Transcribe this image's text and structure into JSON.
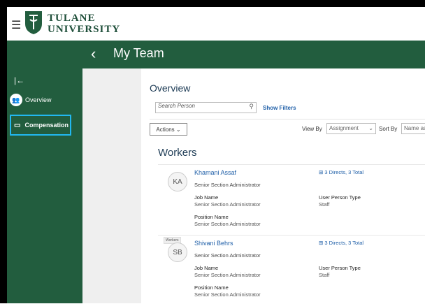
{
  "brand": {
    "line1": "TULANE",
    "line2": "UNIVERSITY"
  },
  "header": {
    "title": "My Team"
  },
  "sidebar": {
    "items": [
      {
        "label": "Overview",
        "icon": "team-icon",
        "active": false
      },
      {
        "label": "Compensation",
        "icon": "compensation-icon",
        "active": true
      }
    ]
  },
  "main": {
    "title": "Overview",
    "search_placeholder": "Search Person",
    "show_filters": "Show Filters",
    "actions_label": "Actions",
    "view_by_label": "View By",
    "view_by_value": "Assignment",
    "sort_by_label": "Sort By",
    "sort_by_value": "Name as",
    "workers_title": "Workers",
    "workers": [
      {
        "initials": "KA",
        "tag": "",
        "name": "Khamani Assaf",
        "role": "Senior Section Administrator",
        "directs": "3 Directs, 3 Total",
        "job_name_label": "Job Name",
        "job_name": "Senior Section Administrator",
        "person_type_label": "User Person Type",
        "person_type": "Staff",
        "position_label": "Position Name",
        "position": "Senior Section Administrator"
      },
      {
        "initials": "SB",
        "tag": "Workers",
        "name": "Shivani Behrs",
        "role": "Senior Section Administrator",
        "directs": "3 Directs, 3 Total",
        "job_name_label": "Job Name",
        "job_name": "Senior Section Administrator",
        "person_type_label": "User Person Type",
        "person_type": "Staff",
        "position_label": "Position Name",
        "position": "Senior Section Administrator"
      }
    ]
  },
  "colors": {
    "brand_green": "#225d3e",
    "link_blue": "#1f5fa8",
    "highlight": "#22b8f0"
  }
}
